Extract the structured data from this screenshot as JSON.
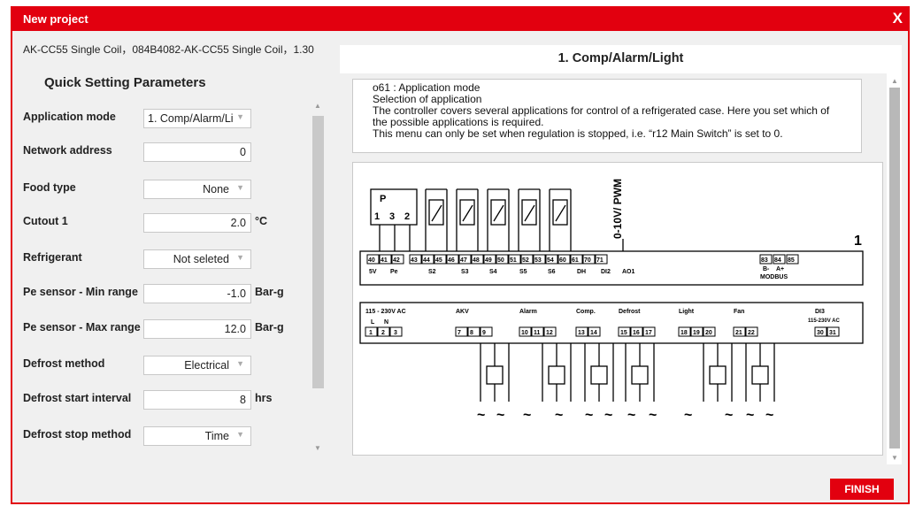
{
  "window": {
    "title": "New project",
    "close_label": "X"
  },
  "device_info": "AK-CC55 Single Coil，084B4082-AK-CC55 Single Coil，1.30",
  "quick_settings": {
    "title": "Quick Setting Parameters",
    "params": [
      {
        "label": "Application mode",
        "value": "1. Comp/Alarm/Li",
        "unit": ""
      },
      {
        "label": "Network address",
        "value": "0",
        "unit": ""
      },
      {
        "label": "Food type",
        "value": "None",
        "unit": ""
      },
      {
        "label": "Cutout 1",
        "value": "2.0",
        "unit": "°C"
      },
      {
        "label": "Refrigerant",
        "value": "Not seleted",
        "unit": ""
      },
      {
        "label": "Pe sensor - Min range",
        "value": "-1.0",
        "unit": "Bar-g"
      },
      {
        "label": "Pe sensor - Max range",
        "value": "12.0",
        "unit": "Bar-g"
      },
      {
        "label": "Defrost method",
        "value": "Electrical",
        "unit": ""
      },
      {
        "label": "Defrost start interval",
        "value": "8",
        "unit": "hrs"
      },
      {
        "label": "Defrost stop method",
        "value": "Time",
        "unit": ""
      }
    ]
  },
  "application": {
    "title": "1. Comp/Alarm/Light",
    "description": [
      "o61 : Application mode",
      "Selection of application",
      "The controller covers several applications for control of a refrigerated case. Here you set which of",
      "the possible applications is required.",
      "This menu can only be set when regulation is stopped, i.e. “r12 Main Switch” is set to 0."
    ]
  },
  "diagram": {
    "p_label": "P",
    "p_terms": [
      "1",
      "3",
      "2"
    ],
    "analog_label": "0-10V/ PWM",
    "board_number": "1",
    "top_terms": [
      "40",
      "41",
      "42",
      "43",
      "44",
      "45",
      "46",
      "47",
      "48",
      "49",
      "50",
      "51",
      "52",
      "53",
      "54",
      "60",
      "61",
      "70",
      "71"
    ],
    "top_labels": [
      "5V",
      "Pe",
      "S2",
      "S3",
      "S4",
      "S5",
      "S6",
      "DH",
      "DI2",
      "AO1"
    ],
    "modbus_terms": [
      "83",
      "84",
      "85"
    ],
    "modbus_sub": [
      "B-",
      "A+"
    ],
    "modbus_label": "MODBUS",
    "power_label": "115 - 230V AC",
    "power_sub": [
      "L",
      "N"
    ],
    "bottom_groups": [
      {
        "label": "AKV",
        "terms": [
          "7",
          "8",
          "9"
        ]
      },
      {
        "label": "Alarm",
        "terms": [
          "10",
          "11",
          "12"
        ]
      },
      {
        "label": "Comp.",
        "terms": [
          "13",
          "14"
        ]
      },
      {
        "label": "Defrost",
        "terms": [
          "15",
          "16",
          "17"
        ]
      },
      {
        "label": "Light",
        "terms": [
          "18",
          "19",
          "20"
        ]
      },
      {
        "label": "Fan",
        "terms": [
          "21",
          "22"
        ]
      },
      {
        "label": "DI3",
        "sublabel": "115-230V AC",
        "terms": [
          "30",
          "31"
        ]
      }
    ],
    "power_terms": [
      "1",
      "2",
      "3"
    ]
  },
  "buttons": {
    "finish": "FINISH"
  },
  "colors": {
    "accent": "#e2000f"
  }
}
